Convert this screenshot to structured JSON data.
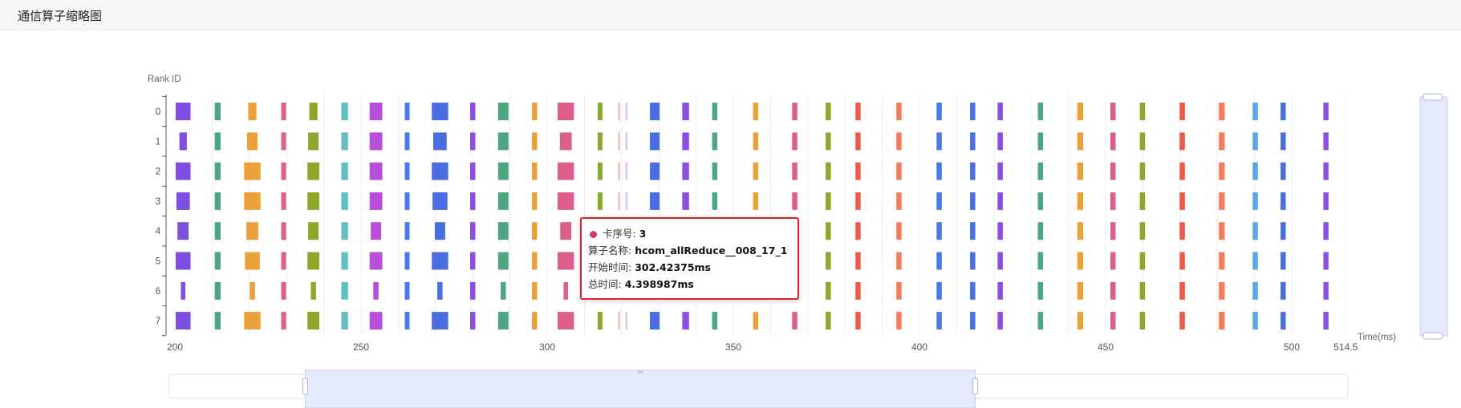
{
  "header": {
    "title": "通信算子缩略图"
  },
  "tooltip": {
    "rank_label": "卡序号:",
    "rank_value": "3",
    "name_label": "算子名称:",
    "name_value": "hcom_allReduce__008_17_1",
    "start_label": "开始时间:",
    "start_value": "302.42375ms",
    "total_label": "总时间:",
    "total_value": "4.398987ms",
    "marker_color": "#c8416e"
  },
  "chart_data": {
    "type": "bar",
    "subtype": "timeline",
    "ylabel": "Rank ID",
    "xlabel": "Time(ms)",
    "xlim": [
      200,
      514.5
    ],
    "x_ticks": [
      "200",
      "250",
      "300",
      "350",
      "400",
      "450",
      "500",
      "514.5"
    ],
    "y_categories": [
      "0",
      "1",
      "2",
      "3",
      "4",
      "5",
      "6",
      "7"
    ],
    "grid": "vertical",
    "zoom_slider": {
      "start": 235,
      "end": 415
    },
    "operators": [
      {
        "center": 202.2,
        "color": "#7f4fe0",
        "durations": [
          4.0,
          2.0,
          4.0,
          3.6,
          3.0,
          4.0,
          1.2,
          4.0
        ]
      },
      {
        "center": 211.5,
        "color": "#4da67f",
        "durations": [
          1.6,
          1.6,
          1.6,
          1.6,
          1.6,
          1.6,
          1.6,
          1.6
        ]
      },
      {
        "center": 220.8,
        "color": "#eba13a",
        "durations": [
          2.2,
          2.8,
          4.4,
          4.4,
          3.2,
          4.0,
          1.4,
          4.4
        ]
      },
      {
        "center": 229.2,
        "color": "#dc5e8c",
        "durations": [
          1.3,
          1.3,
          1.3,
          1.3,
          1.3,
          1.3,
          1.3,
          1.3
        ]
      },
      {
        "center": 237.2,
        "color": "#8ba82c",
        "durations": [
          2.2,
          2.8,
          3.2,
          3.2,
          2.8,
          3.2,
          1.4,
          3.2
        ]
      },
      {
        "center": 245.6,
        "color": "#63bfc5",
        "durations": [
          1.8,
          1.8,
          1.8,
          1.8,
          1.8,
          1.8,
          1.8,
          1.8
        ]
      },
      {
        "center": 254.0,
        "color": "#b84fd8",
        "durations": [
          3.4,
          3.4,
          3.4,
          3.4,
          2.8,
          3.4,
          1.4,
          3.4
        ]
      },
      {
        "center": 262.4,
        "color": "#4a78e8",
        "durations": [
          1.3,
          1.3,
          1.3,
          1.3,
          1.3,
          1.3,
          1.3,
          1.3
        ]
      },
      {
        "center": 271.2,
        "color": "#4a6ee0",
        "durations": [
          4.4,
          3.6,
          4.4,
          4.0,
          2.8,
          4.4,
          1.4,
          4.4
        ]
      },
      {
        "center": 280.0,
        "color": "#8d4fe0",
        "durations": [
          1.4,
          1.4,
          1.4,
          1.4,
          1.4,
          1.4,
          1.4,
          1.4
        ]
      },
      {
        "center": 288.2,
        "color": "#4da67f",
        "durations": [
          2.8,
          2.8,
          2.8,
          2.8,
          2.8,
          2.8,
          1.4,
          2.8
        ]
      },
      {
        "center": 296.6,
        "color": "#eba13a",
        "durations": [
          1.4,
          1.4,
          1.4,
          1.4,
          1.4,
          1.4,
          1.4,
          1.4
        ]
      },
      {
        "center": 305.0,
        "color": "#dc5e8c",
        "durations": [
          4.4,
          3.2,
          4.4,
          4.4,
          3.0,
          4.4,
          1.2,
          4.4
        ]
      },
      {
        "center": 314.2,
        "color": "#8ba82c",
        "durations": [
          1.3,
          1.3,
          1.3,
          1.3,
          1.3,
          1.3,
          1.3,
          1.3
        ]
      },
      {
        "center": 319.3,
        "color": "#ea8a8a",
        "durations": [
          0.3,
          0.3,
          0.3,
          0.3,
          0.3,
          0.3,
          0.3,
          0.3
        ]
      },
      {
        "center": 321.3,
        "color": "#d9c8f0",
        "durations": [
          0.6,
          0.6,
          0.6,
          0.6,
          0.6,
          0.6,
          0.6,
          0.6
        ]
      },
      {
        "center": 328.9,
        "color": "#4a6ee0",
        "durations": [
          2.6,
          2.6,
          2.6,
          2.6,
          2.6,
          2.6,
          2.6,
          2.6
        ]
      },
      {
        "center": 337.2,
        "color": "#8d4fe0",
        "durations": [
          1.8,
          1.8,
          1.8,
          1.8,
          1.8,
          1.8,
          1.8,
          1.8
        ]
      },
      {
        "center": 345.0,
        "color": "#4da67f",
        "durations": [
          1.4,
          1.4,
          1.4,
          1.4,
          1.4,
          1.4,
          1.4,
          1.4
        ]
      },
      {
        "center": 356.0,
        "color": "#eba13a",
        "durations": [
          1.4,
          1.4,
          1.4,
          1.4,
          1.4,
          1.4,
          1.4,
          1.4
        ]
      },
      {
        "center": 366.5,
        "color": "#dc5e8c",
        "durations": [
          1.4,
          1.4,
          1.4,
          1.4,
          1.4,
          1.4,
          1.4,
          1.4
        ]
      },
      {
        "center": 375.5,
        "color": "#8ba82c",
        "durations": [
          1.4,
          1.4,
          1.4,
          1.4,
          1.4,
          1.4,
          1.4,
          1.4
        ]
      },
      {
        "center": 383.5,
        "color": "#f0584a",
        "durations": [
          1.4,
          1.4,
          1.4,
          1.4,
          1.4,
          1.4,
          1.4,
          1.4
        ]
      },
      {
        "center": 394.5,
        "color": "#f07f5a",
        "durations": [
          1.4,
          1.4,
          1.4,
          1.4,
          1.4,
          1.4,
          1.4,
          1.4
        ]
      },
      {
        "center": 405.3,
        "color": "#4a78e8",
        "durations": [
          1.4,
          1.4,
          1.4,
          1.4,
          1.4,
          1.4,
          1.4,
          1.4
        ]
      },
      {
        "center": 414.3,
        "color": "#4a6ee0",
        "durations": [
          1.4,
          1.4,
          1.4,
          1.4,
          1.4,
          1.4,
          1.4,
          1.4
        ]
      },
      {
        "center": 421.7,
        "color": "#8d4fe0",
        "durations": [
          1.4,
          1.4,
          1.4,
          1.4,
          1.4,
          1.4,
          1.4,
          1.4
        ]
      },
      {
        "center": 432.5,
        "color": "#4da67f",
        "durations": [
          1.4,
          1.4,
          1.4,
          1.4,
          1.4,
          1.4,
          1.4,
          1.4
        ]
      },
      {
        "center": 443.2,
        "color": "#eba13a",
        "durations": [
          1.6,
          1.6,
          1.6,
          1.6,
          1.6,
          1.6,
          1.6,
          1.6
        ]
      },
      {
        "center": 452.0,
        "color": "#dc5e8c",
        "durations": [
          1.4,
          1.4,
          1.4,
          1.4,
          1.4,
          1.4,
          1.4,
          1.4
        ]
      },
      {
        "center": 459.9,
        "color": "#8ba82c",
        "durations": [
          1.4,
          1.4,
          1.4,
          1.4,
          1.4,
          1.4,
          1.4,
          1.4
        ]
      },
      {
        "center": 470.6,
        "color": "#f0584a",
        "durations": [
          1.4,
          1.4,
          1.4,
          1.4,
          1.4,
          1.4,
          1.4,
          1.4
        ]
      },
      {
        "center": 481.2,
        "color": "#f07f5a",
        "durations": [
          1.6,
          1.6,
          1.6,
          1.6,
          1.6,
          1.6,
          1.6,
          1.6
        ]
      },
      {
        "center": 490.2,
        "color": "#5aa8e8",
        "durations": [
          1.4,
          1.4,
          1.4,
          1.4,
          1.4,
          1.4,
          1.4,
          1.4
        ]
      },
      {
        "center": 497.7,
        "color": "#4a6ee0",
        "durations": [
          1.4,
          1.4,
          1.4,
          1.4,
          1.4,
          1.4,
          1.4,
          1.4
        ]
      },
      {
        "center": 509.2,
        "color": "#8d4fe0",
        "durations": [
          1.4,
          1.4,
          1.4,
          1.4,
          1.4,
          1.4,
          1.4,
          1.4
        ]
      }
    ]
  }
}
